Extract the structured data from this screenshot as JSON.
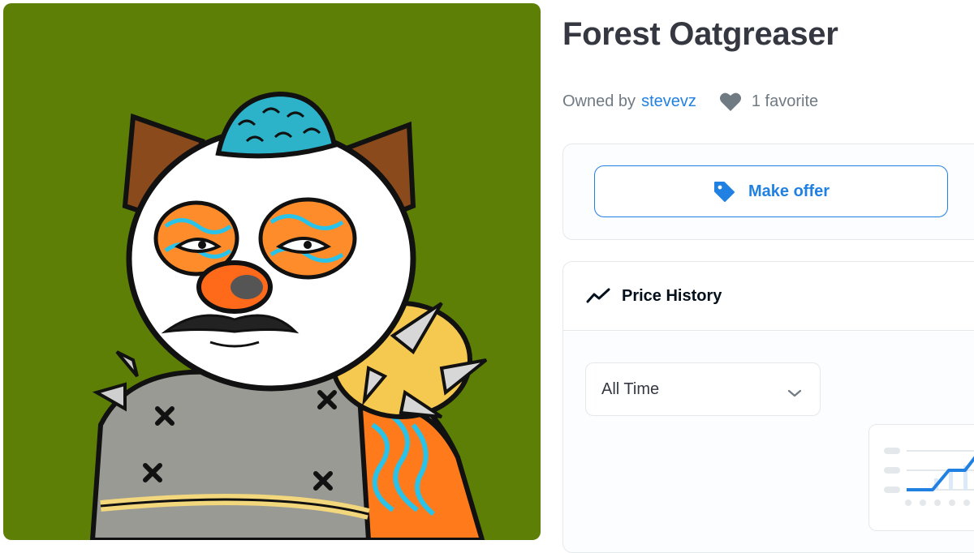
{
  "asset": {
    "title": "Forest Oatgreaser",
    "owned_by_label": "Owned by",
    "owner": "stevevz",
    "favorites": "1 favorite",
    "background_color": "#5e7f06"
  },
  "actions": {
    "make_offer_label": "Make offer"
  },
  "price_history": {
    "title": "Price History",
    "range_selected": "All Time"
  },
  "icons": {
    "heart": "heart-icon",
    "offer": "price-tag-icon",
    "history": "trend-line-icon",
    "dropdown": "chevron-down-icon"
  },
  "colors": {
    "accent": "#2081e2",
    "text": "#353840",
    "muted": "#707a83",
    "border": "#e5e8eb"
  }
}
